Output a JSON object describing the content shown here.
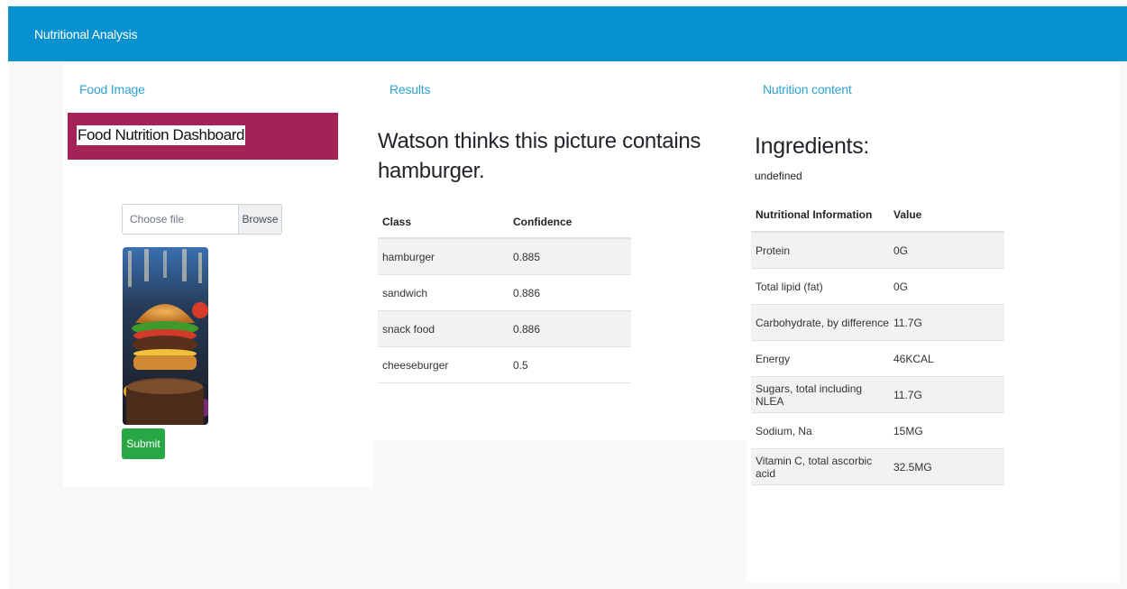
{
  "navbar": {
    "brand": "Nutritional Analysis"
  },
  "columns": {
    "food_image": "Food Image",
    "results": "Results",
    "nutrition_content": "Nutrition content"
  },
  "food_panel": {
    "dashboard_title": "Food Nutrition Dashboard",
    "file_placeholder": "Choose file",
    "browse_label": "Browse",
    "image_alt": "hamburger-photo",
    "submit_label": "Submit"
  },
  "results": {
    "heading": "Watson thinks this picture contains hamburger.",
    "columns": [
      "Class",
      "Confidence"
    ],
    "rows": [
      {
        "class": "hamburger",
        "confidence": "0.885"
      },
      {
        "class": "sandwich",
        "confidence": "0.886"
      },
      {
        "class": "snack food",
        "confidence": "0.886"
      },
      {
        "class": "cheeseburger",
        "confidence": "0.5"
      }
    ]
  },
  "nutrition": {
    "heading": "Ingredients:",
    "ingredients_text": "undefined",
    "columns": [
      "Nutritional Information",
      "Value"
    ],
    "rows": [
      {
        "name": "Protein",
        "value": "0G"
      },
      {
        "name": "Total lipid (fat)",
        "value": "0G"
      },
      {
        "name": "Carbohydrate, by difference",
        "value": "11.7G"
      },
      {
        "name": "Energy",
        "value": "46KCAL"
      },
      {
        "name": "Sugars, total including NLEA",
        "value": "11.7G"
      },
      {
        "name": "Sodium, Na",
        "value": "15MG"
      },
      {
        "name": "Vitamin C, total ascorbic acid",
        "value": "32.5MG"
      }
    ]
  },
  "colors": {
    "navbar": "#0891cf",
    "heading_accent": "#2fa3d6",
    "dashboard_banner": "#a52256",
    "submit_button": "#28a745"
  }
}
